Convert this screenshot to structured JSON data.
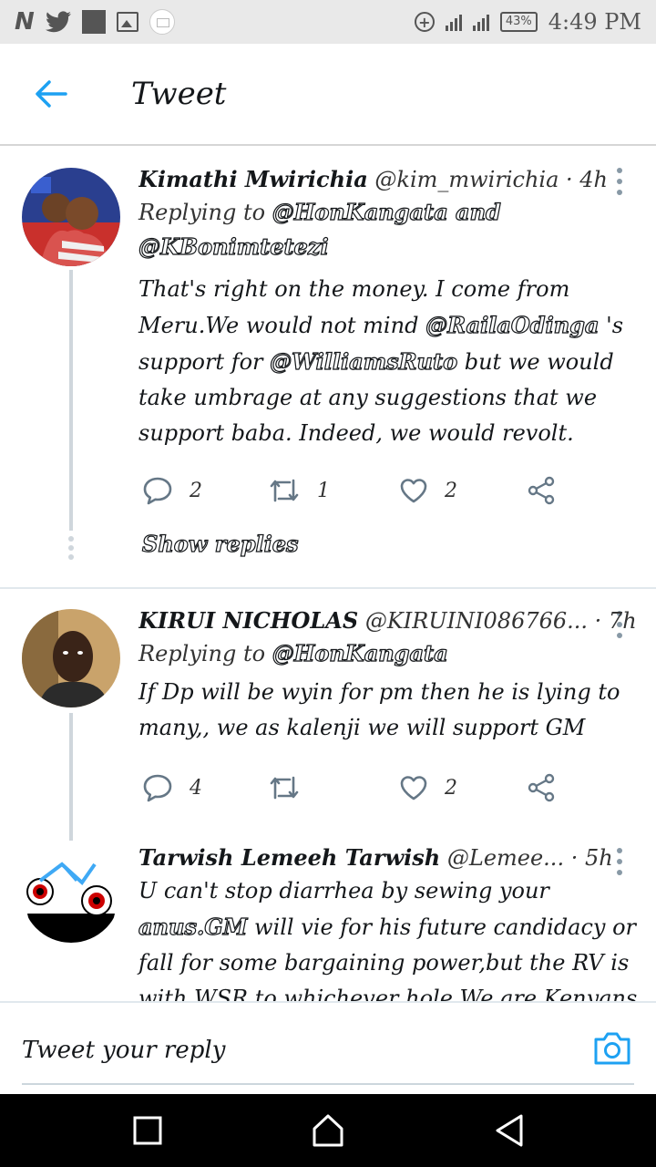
{
  "colors": {
    "accent": "#1da1f2",
    "icon_gray": "#657786",
    "divider": "#e1e8ed",
    "thread_line": "#cfd6dc"
  },
  "status_bar": {
    "left_icons": [
      "n-logo-icon",
      "twitter-bird-icon",
      "square-notification-icon",
      "image-icon",
      "mail-icon"
    ],
    "right_icons": [
      "add-circle-icon",
      "signal-icon",
      "signal-4g-icon"
    ],
    "n_glyph": "N",
    "plus_glyph": "+",
    "battery": "43%",
    "time": "4:49 PM"
  },
  "header": {
    "title": "Tweet",
    "back_icon": "arrow-left-icon"
  },
  "tweets": [
    {
      "name": "Kimathi Mwirichia",
      "handle": "@kim_mwirichia",
      "time": "· 4h",
      "reply_prefix": "Replying to",
      "reply_mention_1": "@HonKangata and",
      "reply_mention_2": "@KBonimtetezi",
      "text_1": "That's right on the money. I come from Meru.We would not mind ",
      "mention_a": "@RailaOdinga",
      "text_2": " 's support for ",
      "mention_b": "@WilliamsRuto",
      "text_3": " but we would take umbrage at any suggestions that we support baba. Indeed, we would revolt.",
      "replies": "2",
      "retweets": "1",
      "likes": "2",
      "show_replies": "Show replies"
    },
    {
      "name": "KIRUI NICHOLAS",
      "handle": "@KIRUINI086766...",
      "time": "· 7h",
      "reply_prefix": "Replying to",
      "reply_mention_1": "@HonKangata",
      "text_1": "If Dp will be wyin for pm then he is lying to many,, we as kalenji we will support GM",
      "replies": "4",
      "retweets": "",
      "likes": "2"
    },
    {
      "name": "Tarwish Lemeeh Tarwish",
      "handle": "@Lemee...",
      "time": "· 5h",
      "text_1": "U can't stop  diarrhea by sewing your ",
      "mention_a": "anus.GM",
      "text_2": " will vie for his future candidacy or fall for some bargaining power,but the RV is with WSR to whichever hole.We are Kenyans and"
    }
  ],
  "reply_bar": {
    "placeholder": "Tweet your reply",
    "camera_icon": "camera-icon"
  },
  "nav_bar": {
    "icons": [
      "recent-apps-icon",
      "home-icon",
      "back-triangle-icon"
    ]
  }
}
